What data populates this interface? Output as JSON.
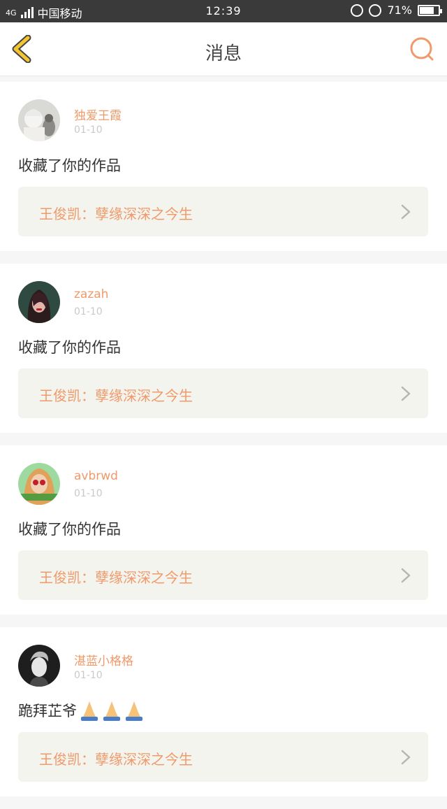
{
  "status": {
    "network": "4G",
    "carrier": "中国移动",
    "time": "12:39",
    "battery": "71%",
    "battery_level": 0.71
  },
  "header": {
    "title": "消息"
  },
  "messages": [
    {
      "user": "独爱王霞",
      "date": "01-10",
      "action": "收藏了你的作品",
      "work": "王俊凯：孽缘深深之今生"
    },
    {
      "user": "zazah",
      "date": "01-10",
      "action": "收藏了你的作品",
      "work": "王俊凯：孽缘深深之今生"
    },
    {
      "user": "avbrwd",
      "date": "01-10",
      "action": "收藏了你的作品",
      "work": "王俊凯：孽缘深深之今生"
    },
    {
      "user": "湛蓝小格格",
      "date": "01-10",
      "action": "跪拜芷爷",
      "work": "王俊凯：孽缘深深之今生"
    }
  ],
  "colors": {
    "accent": "#ef9a6a",
    "back_arrow": "#f2c531"
  }
}
